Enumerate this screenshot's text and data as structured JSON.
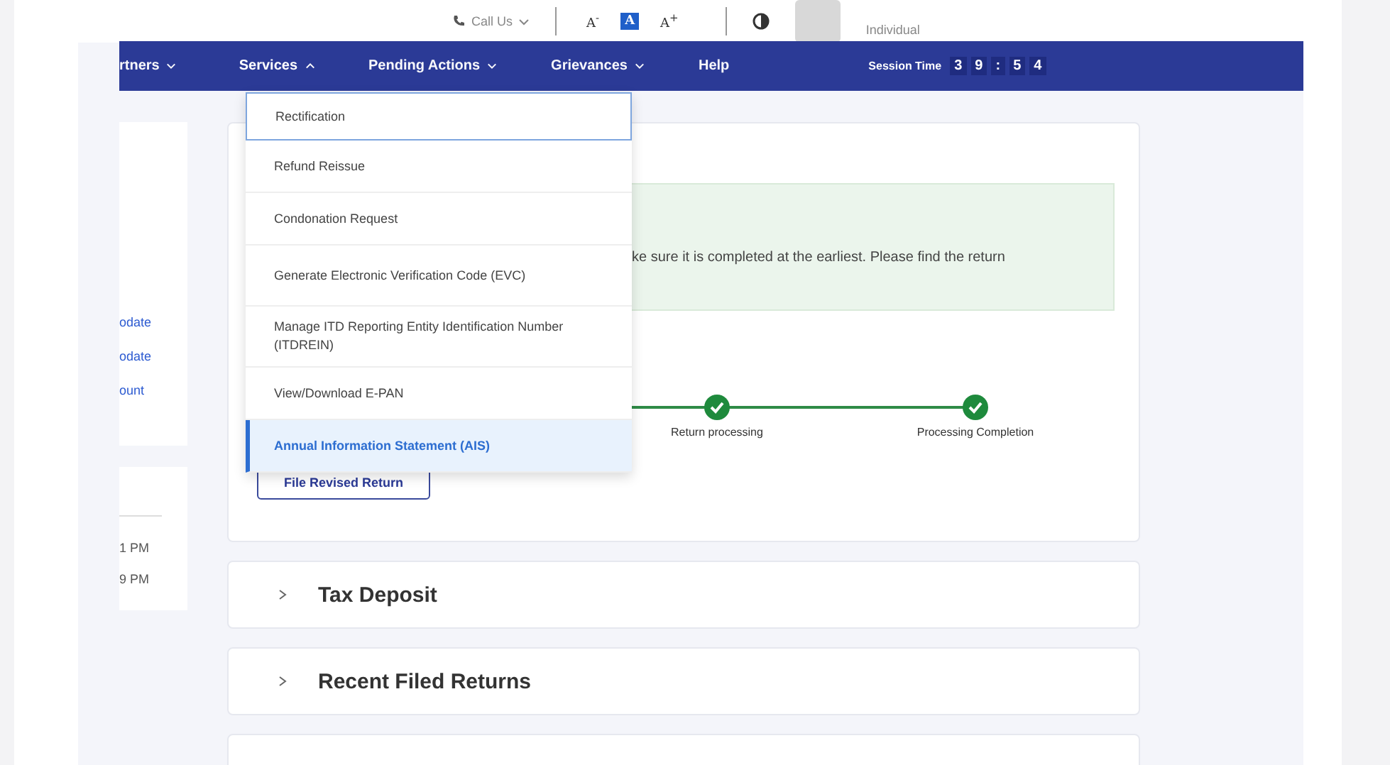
{
  "top_bar": {
    "call_us": "Call Us",
    "font_size_controls": [
      {
        "label": "A$^{-}$",
        "selected": false
      },
      {
        "label": "A",
        "selected": true
      },
      {
        "label": "A$^{+}$",
        "selected": false
      }
    ],
    "user_type": "Individual"
  },
  "nav": {
    "items": [
      {
        "label": "rtners",
        "has_menu": true,
        "expanded": false
      },
      {
        "label": "Services",
        "has_menu": true,
        "expanded": true
      },
      {
        "label": "Pending Actions",
        "has_menu": true,
        "expanded": false
      },
      {
        "label": "Grievances",
        "has_menu": true,
        "expanded": false
      },
      {
        "label": "Help",
        "has_menu": false
      }
    ],
    "session_label": "Session Time",
    "session_digits": [
      "3",
      "9",
      ":",
      "5",
      "4"
    ]
  },
  "services_menu": [
    {
      "label": "Rectification",
      "selected": false,
      "focused": true
    },
    {
      "label": "Refund Reissue",
      "selected": false,
      "focused": false
    },
    {
      "label": "Condonation Request",
      "selected": false,
      "focused": false
    },
    {
      "label": "Generate Electronic Verification Code (EVC)",
      "selected": false,
      "focused": false
    },
    {
      "label": "Manage ITD Reporting Entity Identification Number (ITDREIN)",
      "selected": false,
      "focused": false
    },
    {
      "label": "View/Download E-PAN",
      "selected": false,
      "focused": false
    },
    {
      "label": "Annual Information Statement (AIS)",
      "selected": true,
      "focused": false
    }
  ],
  "side_links": [
    "odate",
    "odate",
    "ount"
  ],
  "side_times": [
    "1 PM",
    "9 PM"
  ],
  "alert_text": "ke sure it is completed at the earliest. Please find the return",
  "steps": [
    {
      "label": "Return processing",
      "done": true
    },
    {
      "label": "Processing Completion",
      "done": true
    }
  ],
  "revise_button": "File Revised Return",
  "accordions": [
    {
      "title": "Tax Deposit",
      "expanded": false
    },
    {
      "title": "Recent Filed Returns",
      "expanded": false
    }
  ]
}
